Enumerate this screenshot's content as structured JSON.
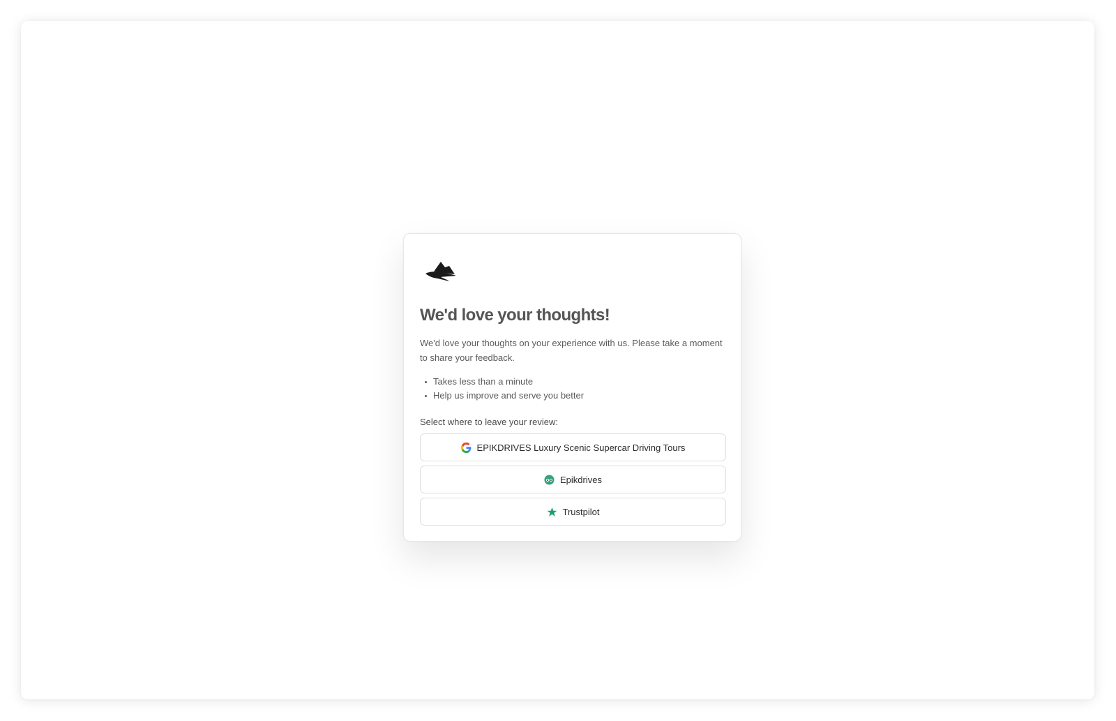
{
  "card": {
    "title": "We'd love your thoughts!",
    "intro": "We'd love your thoughts on your experience with us. Please take a moment to share your feedback.",
    "bullets": [
      "Takes less than a minute",
      "Help us improve and serve you better"
    ],
    "select_label": "Select where to leave your review:"
  },
  "review_options": [
    {
      "label": "EPIKDRIVES Luxury Scenic Supercar Driving Tours",
      "icon": "google-icon"
    },
    {
      "label": "Epikdrives",
      "icon": "tripadvisor-icon",
      "color": "#34a37d"
    },
    {
      "label": "Trustpilot",
      "icon": "trustpilot-star-icon",
      "color": "#1aa26a"
    }
  ],
  "logo": {
    "icon": "epikdrives-logo-icon"
  }
}
